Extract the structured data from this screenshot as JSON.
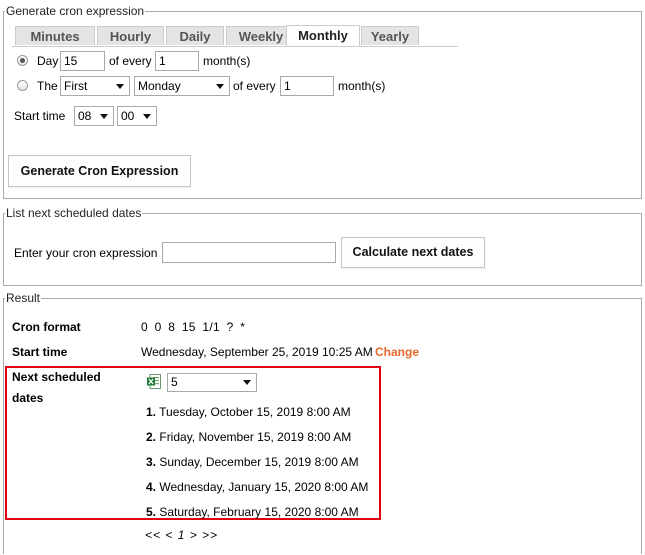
{
  "generate": {
    "legend": "Generate cron expression",
    "tabs": [
      "Minutes",
      "Hourly",
      "Daily",
      "Weekly",
      "Monthly",
      "Yearly"
    ],
    "active_tab": "Monthly",
    "option1": {
      "day_label": "Day",
      "day_value": "15",
      "of_every_label": "of every",
      "of_every_value": "1",
      "months_label": "month(s)"
    },
    "option2": {
      "the_label": "The",
      "ordinal_value": "First",
      "weekday_value": "Monday",
      "of_every_label": "of every",
      "of_every_value": "1",
      "months_label": "month(s)"
    },
    "start_time": {
      "label": "Start time",
      "hour": "08",
      "minute": "00"
    },
    "button_label": "Generate Cron Expression"
  },
  "next_dates": {
    "legend": "List next scheduled dates",
    "input_label": "Enter your cron expression",
    "input_value": "",
    "button_label": "Calculate next dates"
  },
  "result": {
    "legend": "Result",
    "cron_format_label": "Cron format",
    "cron_format_value": "0 0 8 15 1/1 ? *",
    "start_time_label": "Start time",
    "start_time_value": "Wednesday, September 25, 2019 10:25 AM",
    "change_link": "Change",
    "next_scheduled_label_1": "Next scheduled",
    "next_scheduled_label_2": "dates",
    "count_value": "5",
    "dates": [
      {
        "num": "1.",
        "text": "Tuesday, October 15, 2019 8:00 AM"
      },
      {
        "num": "2.",
        "text": "Friday, November 15, 2019 8:00 AM"
      },
      {
        "num": "3.",
        "text": "Sunday, December 15, 2019 8:00 AM"
      },
      {
        "num": "4.",
        "text": "Wednesday, January 15, 2020 8:00 AM"
      },
      {
        "num": "5.",
        "text": "Saturday, February 15, 2020 8:00 AM"
      }
    ],
    "pager": "<< < 1 > >>"
  },
  "colors": {
    "link": "#e8682a",
    "highlight_border": "#e00010",
    "excel_green": "#1e7b34"
  },
  "icons": {
    "excel": "excel-icon",
    "dropdown": "chevron-down-icon"
  }
}
